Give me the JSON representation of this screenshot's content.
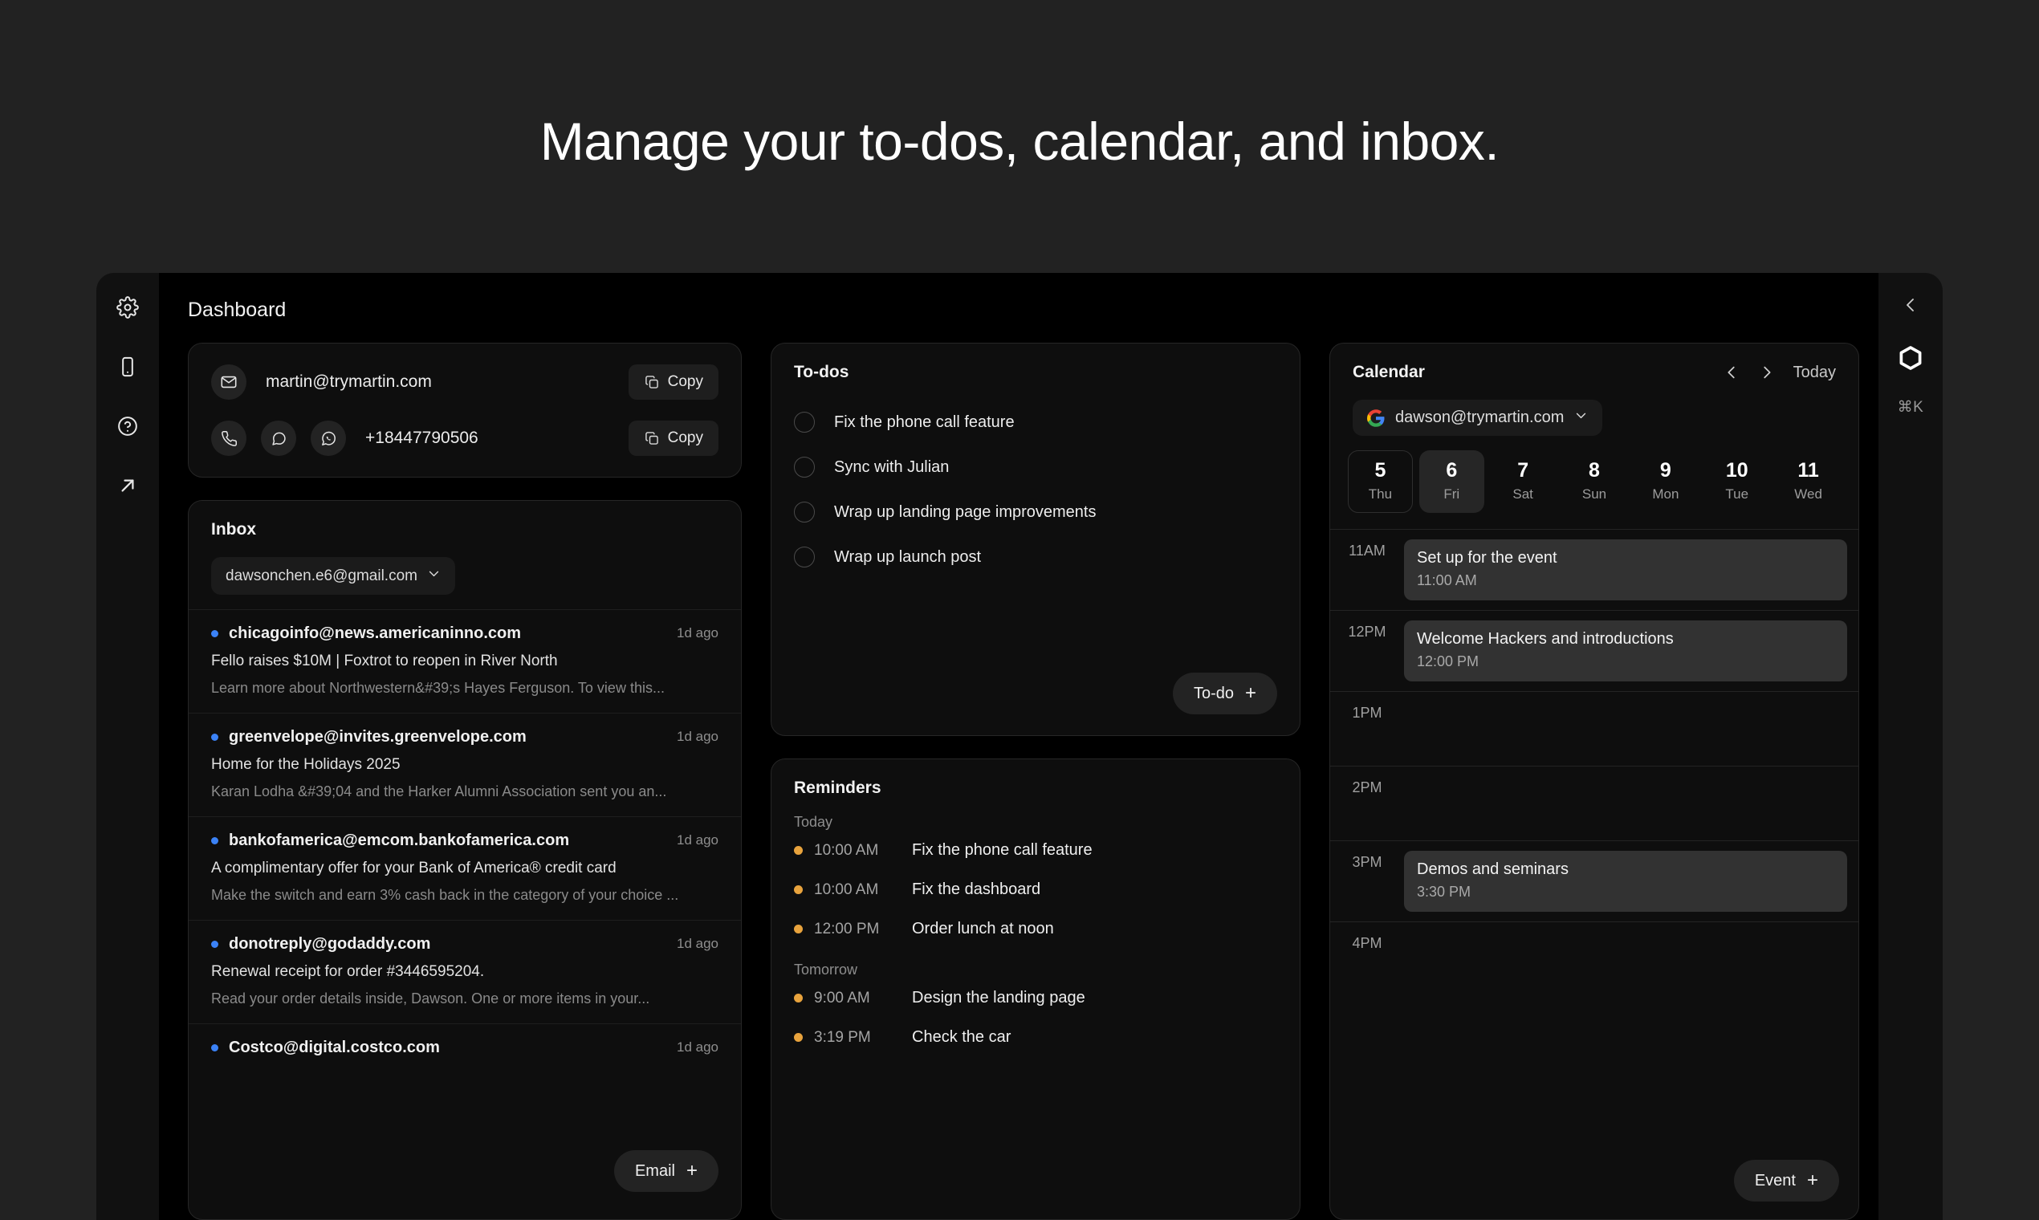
{
  "headline": "Manage your to-dos, calendar, and inbox.",
  "left_rail": {
    "items": [
      {
        "icon": "gear-icon"
      },
      {
        "icon": "mobile-icon"
      },
      {
        "icon": "help-circle-icon"
      },
      {
        "icon": "external-link-icon"
      }
    ]
  },
  "right_rail": {
    "collapse_icon": "chevron-left-icon",
    "logo_icon": "hexagon-logo-icon",
    "shortcut": "⌘K"
  },
  "dashboard": {
    "title": "Dashboard"
  },
  "contact": {
    "email": "martin@trymartin.com",
    "email_copy_label": "Copy",
    "phone": "+18447790506",
    "phone_copy_label": "Copy",
    "email_icon": "envelope-icon",
    "call_icon": "phone-icon",
    "message_icon": "message-bubble-icon",
    "whatsapp_icon": "whatsapp-icon",
    "copy_icon": "copy-icon"
  },
  "inbox": {
    "title": "Inbox",
    "account": "dawsonchen.e6@gmail.com",
    "account_chevron_icon": "chevron-down-icon",
    "add_label": "Email",
    "messages": [
      {
        "from": "chicagoinfo@news.americaninno.com",
        "age": "1d ago",
        "subject": "Fello raises $10M | Foxtrot to reopen in River North",
        "snippet": "Learn more about Northwestern&#39;s Hayes Ferguson. To view this..."
      },
      {
        "from": "greenvelope@invites.greenvelope.com",
        "age": "1d ago",
        "subject": "Home for the Holidays 2025",
        "snippet": "Karan Lodha &#39;04 and the Harker Alumni Association sent you an..."
      },
      {
        "from": "bankofamerica@emcom.bankofamerica.com",
        "age": "1d ago",
        "subject": "A complimentary offer for your Bank of America® credit card",
        "snippet": "Make the switch and earn 3% cash back in the category of your choice  ..."
      },
      {
        "from": "donotreply@godaddy.com",
        "age": "1d ago",
        "subject": "Renewal receipt for order #3446595204.",
        "snippet": "Read your order details inside, Dawson. One or more items in your..."
      },
      {
        "from": "Costco@digital.costco.com",
        "age": "1d ago",
        "subject": "",
        "snippet": ""
      }
    ]
  },
  "todos": {
    "title": "To-dos",
    "add_label": "To-do",
    "items": [
      {
        "label": "Fix the phone call feature",
        "done": false
      },
      {
        "label": "Sync with Julian",
        "done": false
      },
      {
        "label": "Wrap up landing page improvements",
        "done": false
      },
      {
        "label": "Wrap up launch post",
        "done": false
      }
    ]
  },
  "reminders": {
    "title": "Reminders",
    "groups": [
      {
        "label": "Today",
        "items": [
          {
            "time": "10:00 AM",
            "text": "Fix the phone call feature"
          },
          {
            "time": "10:00 AM",
            "text": "Fix the dashboard"
          },
          {
            "time": "12:00 PM",
            "text": "Order lunch at noon"
          }
        ]
      },
      {
        "label": "Tomorrow",
        "items": [
          {
            "time": "9:00 AM",
            "text": "Design the landing page"
          },
          {
            "time": "3:19 PM",
            "text": "Check the car"
          }
        ]
      }
    ]
  },
  "calendar": {
    "title": "Calendar",
    "prev_icon": "chevron-left-icon",
    "next_icon": "chevron-right-icon",
    "today_label": "Today",
    "account": "dawson@trymartin.com",
    "account_icon": "google-icon",
    "account_chevron_icon": "chevron-down-icon",
    "add_label": "Event",
    "days": [
      {
        "num": "5",
        "name": "Thu",
        "state": "outlined"
      },
      {
        "num": "6",
        "name": "Fri",
        "state": "selected"
      },
      {
        "num": "7",
        "name": "Sat",
        "state": ""
      },
      {
        "num": "8",
        "name": "Sun",
        "state": ""
      },
      {
        "num": "9",
        "name": "Mon",
        "state": ""
      },
      {
        "num": "10",
        "name": "Tue",
        "state": ""
      },
      {
        "num": "11",
        "name": "Wed",
        "state": ""
      }
    ],
    "hours": [
      {
        "label": "11AM",
        "event": {
          "title": "Set up for the event",
          "time": "11:00 AM"
        }
      },
      {
        "label": "12PM",
        "event": {
          "title": "Welcome Hackers and introductions",
          "time": "12:00 PM"
        }
      },
      {
        "label": "1PM",
        "event": null
      },
      {
        "label": "2PM",
        "event": null
      },
      {
        "label": "3PM",
        "event": {
          "title": "Demos and seminars",
          "time": "3:30 PM"
        }
      },
      {
        "label": "4PM",
        "event": null
      }
    ]
  },
  "colors": {
    "page_bg": "#222222",
    "rail_bg": "#111111",
    "app_bg": "#000000",
    "card_bg": "#0e0e0e",
    "unread_dot": "#3b82f6",
    "reminder_dot": "#e8a33d",
    "event_bg": "#323232"
  }
}
